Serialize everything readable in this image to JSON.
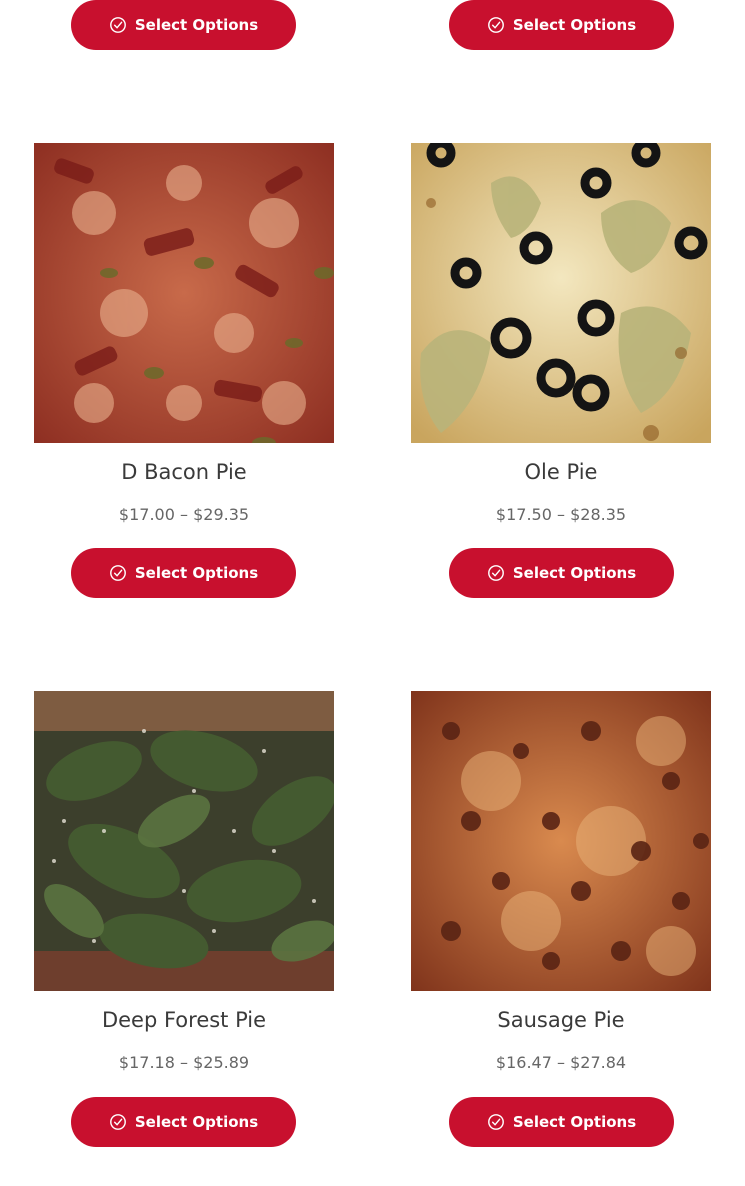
{
  "colors": {
    "accent": "#c8102e",
    "title": "#3a3a3a",
    "price": "#666666"
  },
  "button_label": "Select Options",
  "button_icon": "check-circle-icon",
  "products": [
    {
      "name": "D Bacon Pie",
      "price": "$17.00 – $29.35",
      "image": "bacon-pizza-photo"
    },
    {
      "name": "Ole Pie",
      "price": "$17.50 – $28.35",
      "image": "olive-artichoke-pizza-photo"
    },
    {
      "name": "Deep Forest Pie",
      "price": "$17.18 – $25.89",
      "image": "spinach-pizza-photo"
    },
    {
      "name": "Sausage Pie",
      "price": "$16.47 – $27.84",
      "image": "sausage-pizza-photo"
    }
  ]
}
